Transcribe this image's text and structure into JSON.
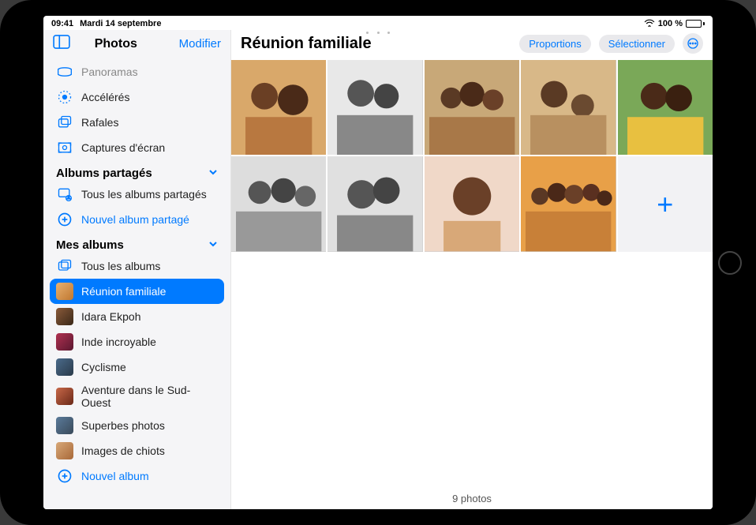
{
  "status": {
    "time": "09:41",
    "date": "Mardi 14 septembre",
    "battery_pct": "100 %"
  },
  "sidebar": {
    "title": "Photos",
    "edit": "Modifier",
    "media_types": {
      "panoramas": "Panoramas",
      "acceleres": "Accélérés",
      "rafales": "Rafales",
      "captures": "Captures d'écran"
    },
    "shared": {
      "header": "Albums partagés",
      "all": "Tous les albums partagés",
      "new": "Nouvel album partagé"
    },
    "my": {
      "header": "Mes albums",
      "all": "Tous les albums",
      "items": [
        {
          "label": "Réunion familiale"
        },
        {
          "label": "Idara Ekpoh"
        },
        {
          "label": "Inde incroyable"
        },
        {
          "label": "Cyclisme"
        },
        {
          "label": "Aventure dans le Sud-Ouest"
        },
        {
          "label": "Superbes photos"
        },
        {
          "label": "Images de chiots"
        }
      ],
      "new": "Nouvel album"
    }
  },
  "content": {
    "title": "Réunion familiale",
    "proportions": "Proportions",
    "select": "Sélectionner",
    "footer": "9 photos"
  }
}
